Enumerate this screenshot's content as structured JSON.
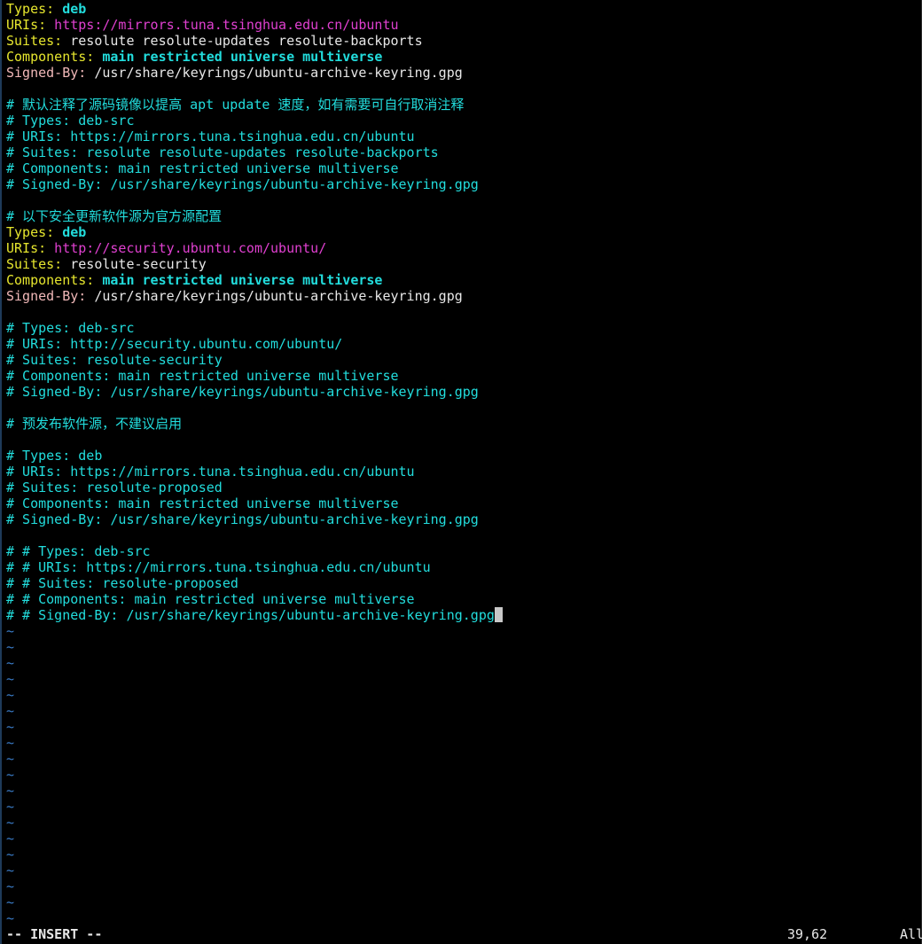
{
  "editor": {
    "lines": [
      {
        "kind": "kv",
        "key": "Types:",
        "value": " deb",
        "value_style": "val-bold"
      },
      {
        "kind": "kv",
        "key": "URIs:",
        "value": " https://mirrors.tuna.tsinghua.edu.cn/ubuntu",
        "value_style": "val-url"
      },
      {
        "kind": "kv",
        "key": "Suites:",
        "value": " resolute resolute-updates resolute-backports",
        "value_style": "val"
      },
      {
        "kind": "kv",
        "key": "Components:",
        "value": " main restricted universe multiverse",
        "value_style": "val-bold"
      },
      {
        "kind": "signed",
        "key": "Signed-By:",
        "value": " /usr/share/keyrings/ubuntu-archive-keyring.gpg"
      },
      {
        "kind": "blank"
      },
      {
        "kind": "comment",
        "text": "# 默认注释了源码镜像以提高 apt update 速度，如有需要可自行取消注释"
      },
      {
        "kind": "comment",
        "text": "# Types: deb-src"
      },
      {
        "kind": "comment",
        "text": "# URIs: https://mirrors.tuna.tsinghua.edu.cn/ubuntu"
      },
      {
        "kind": "comment",
        "text": "# Suites: resolute resolute-updates resolute-backports"
      },
      {
        "kind": "comment",
        "text": "# Components: main restricted universe multiverse"
      },
      {
        "kind": "comment",
        "text": "# Signed-By: /usr/share/keyrings/ubuntu-archive-keyring.gpg"
      },
      {
        "kind": "blank"
      },
      {
        "kind": "comment",
        "text": "# 以下安全更新软件源为官方源配置"
      },
      {
        "kind": "kv",
        "key": "Types:",
        "value": " deb",
        "value_style": "val-bold"
      },
      {
        "kind": "kv",
        "key": "URIs:",
        "value": " http://security.ubuntu.com/ubuntu/",
        "value_style": "val-url"
      },
      {
        "kind": "kv",
        "key": "Suites:",
        "value": " resolute-security",
        "value_style": "val"
      },
      {
        "kind": "kv",
        "key": "Components:",
        "value": " main restricted universe multiverse",
        "value_style": "val-bold"
      },
      {
        "kind": "signed",
        "key": "Signed-By:",
        "value": " /usr/share/keyrings/ubuntu-archive-keyring.gpg"
      },
      {
        "kind": "blank"
      },
      {
        "kind": "comment",
        "text": "# Types: deb-src"
      },
      {
        "kind": "comment",
        "text": "# URIs: http://security.ubuntu.com/ubuntu/"
      },
      {
        "kind": "comment",
        "text": "# Suites: resolute-security"
      },
      {
        "kind": "comment",
        "text": "# Components: main restricted universe multiverse"
      },
      {
        "kind": "comment",
        "text": "# Signed-By: /usr/share/keyrings/ubuntu-archive-keyring.gpg"
      },
      {
        "kind": "blank"
      },
      {
        "kind": "comment",
        "text": "# 预发布软件源，不建议启用"
      },
      {
        "kind": "blank"
      },
      {
        "kind": "comment",
        "text": "# Types: deb"
      },
      {
        "kind": "comment",
        "text": "# URIs: https://mirrors.tuna.tsinghua.edu.cn/ubuntu"
      },
      {
        "kind": "comment",
        "text": "# Suites: resolute-proposed"
      },
      {
        "kind": "comment",
        "text": "# Components: main restricted universe multiverse"
      },
      {
        "kind": "comment",
        "text": "# Signed-By: /usr/share/keyrings/ubuntu-archive-keyring.gpg"
      },
      {
        "kind": "blank"
      },
      {
        "kind": "comment",
        "text": "# # Types: deb-src"
      },
      {
        "kind": "comment",
        "text": "# # URIs: https://mirrors.tuna.tsinghua.edu.cn/ubuntu"
      },
      {
        "kind": "comment",
        "text": "# # Suites: resolute-proposed"
      },
      {
        "kind": "comment",
        "text": "# # Components: main restricted universe multiverse"
      },
      {
        "kind": "comment",
        "text": "# # Signed-By: /usr/share/keyrings/ubuntu-archive-keyring.gpg",
        "cursor": true
      }
    ],
    "empty_line_marker": "~",
    "empty_line_count": 19
  },
  "statusline": {
    "mode": "-- INSERT --",
    "ruler": "39,62",
    "scroll_position": "All"
  },
  "colors": {
    "background": "#000000",
    "key": "#e6e62e",
    "comment": "#22dddd",
    "url": "#e040d0",
    "tilde": "#3a7cc8",
    "cursor": "#c8c8c8"
  }
}
